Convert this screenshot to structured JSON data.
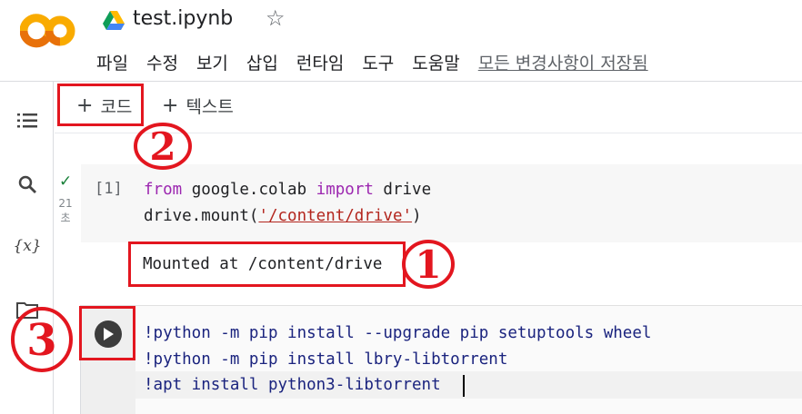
{
  "app": {
    "notebook_title": "test.ipynb",
    "logo_icon": "colab-logo-icon",
    "drive_icon": "google-drive-icon",
    "star_glyph": "☆"
  },
  "menu": {
    "items": [
      "파일",
      "수정",
      "보기",
      "삽입",
      "런타임",
      "도구",
      "도움말"
    ],
    "save_status": "모든 변경사항이 저장됨"
  },
  "sidebar": {
    "icons": [
      "table-of-contents-icon",
      "search-icon",
      "variables-icon",
      "files-folder-icon"
    ],
    "variables_glyph": "{x}"
  },
  "toolbar": {
    "plus_glyph": "+",
    "add_code_label": "코드",
    "add_text_label": "텍스트"
  },
  "cell1": {
    "status_glyph": "✓",
    "exec_time": "21",
    "exec_time_unit": "초",
    "exec_count": "[1]",
    "code_line1": {
      "kw_from": "from",
      "module": " google.colab ",
      "kw_import": "import",
      "name": " drive"
    },
    "code_line2": {
      "prefix": "drive.mount(",
      "arg": "'/content/drive'",
      "suffix": ")"
    },
    "output": "Mounted at /content/drive"
  },
  "cell2": {
    "lines": [
      "!python -m pip install --upgrade pip setuptools wheel",
      "!python -m pip install lbry-libtorrent",
      "!apt install python3-libtorrent"
    ]
  },
  "annotations": {
    "one": "1",
    "two": "2",
    "three": "3"
  },
  "colors": {
    "annotation_red": "#e3161f",
    "logo_orange": "#f9ab00",
    "logo_dark_orange": "#e8710a",
    "keyword_purple": "#9c27b0",
    "string_red": "#b3261e",
    "success_green": "#188038"
  }
}
